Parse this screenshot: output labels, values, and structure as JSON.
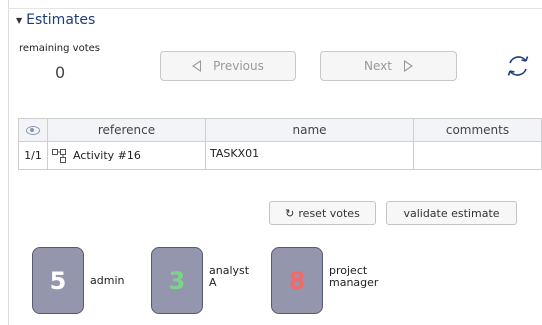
{
  "section": {
    "title": "Estimates"
  },
  "votes": {
    "remaining_label": "remaining votes",
    "remaining_count": "0"
  },
  "navigation": {
    "previous_label": "Previous",
    "next_label": "Next"
  },
  "table": {
    "columns": {
      "reference": "reference",
      "name": "name",
      "comments": "comments"
    },
    "rows": [
      {
        "index": "1/1",
        "reference": "Activity #16",
        "name": "TASKX01",
        "comments": ""
      }
    ]
  },
  "actions": {
    "reset_votes_label": "reset votes",
    "validate_label": "validate estimate"
  },
  "voters": [
    {
      "score": "5",
      "name": "admin",
      "score_color": "#ffffff"
    },
    {
      "score": "3",
      "name_line1": "analyst",
      "name_line2": "A",
      "score_color": "#7ed38c"
    },
    {
      "score": "8",
      "name_line1": "project",
      "name_line2": "manager",
      "score_color": "#f06a6a"
    }
  ],
  "colors": {
    "title": "#1e3c78",
    "card_fill": "#9496ad",
    "card_border": "#585b70"
  }
}
